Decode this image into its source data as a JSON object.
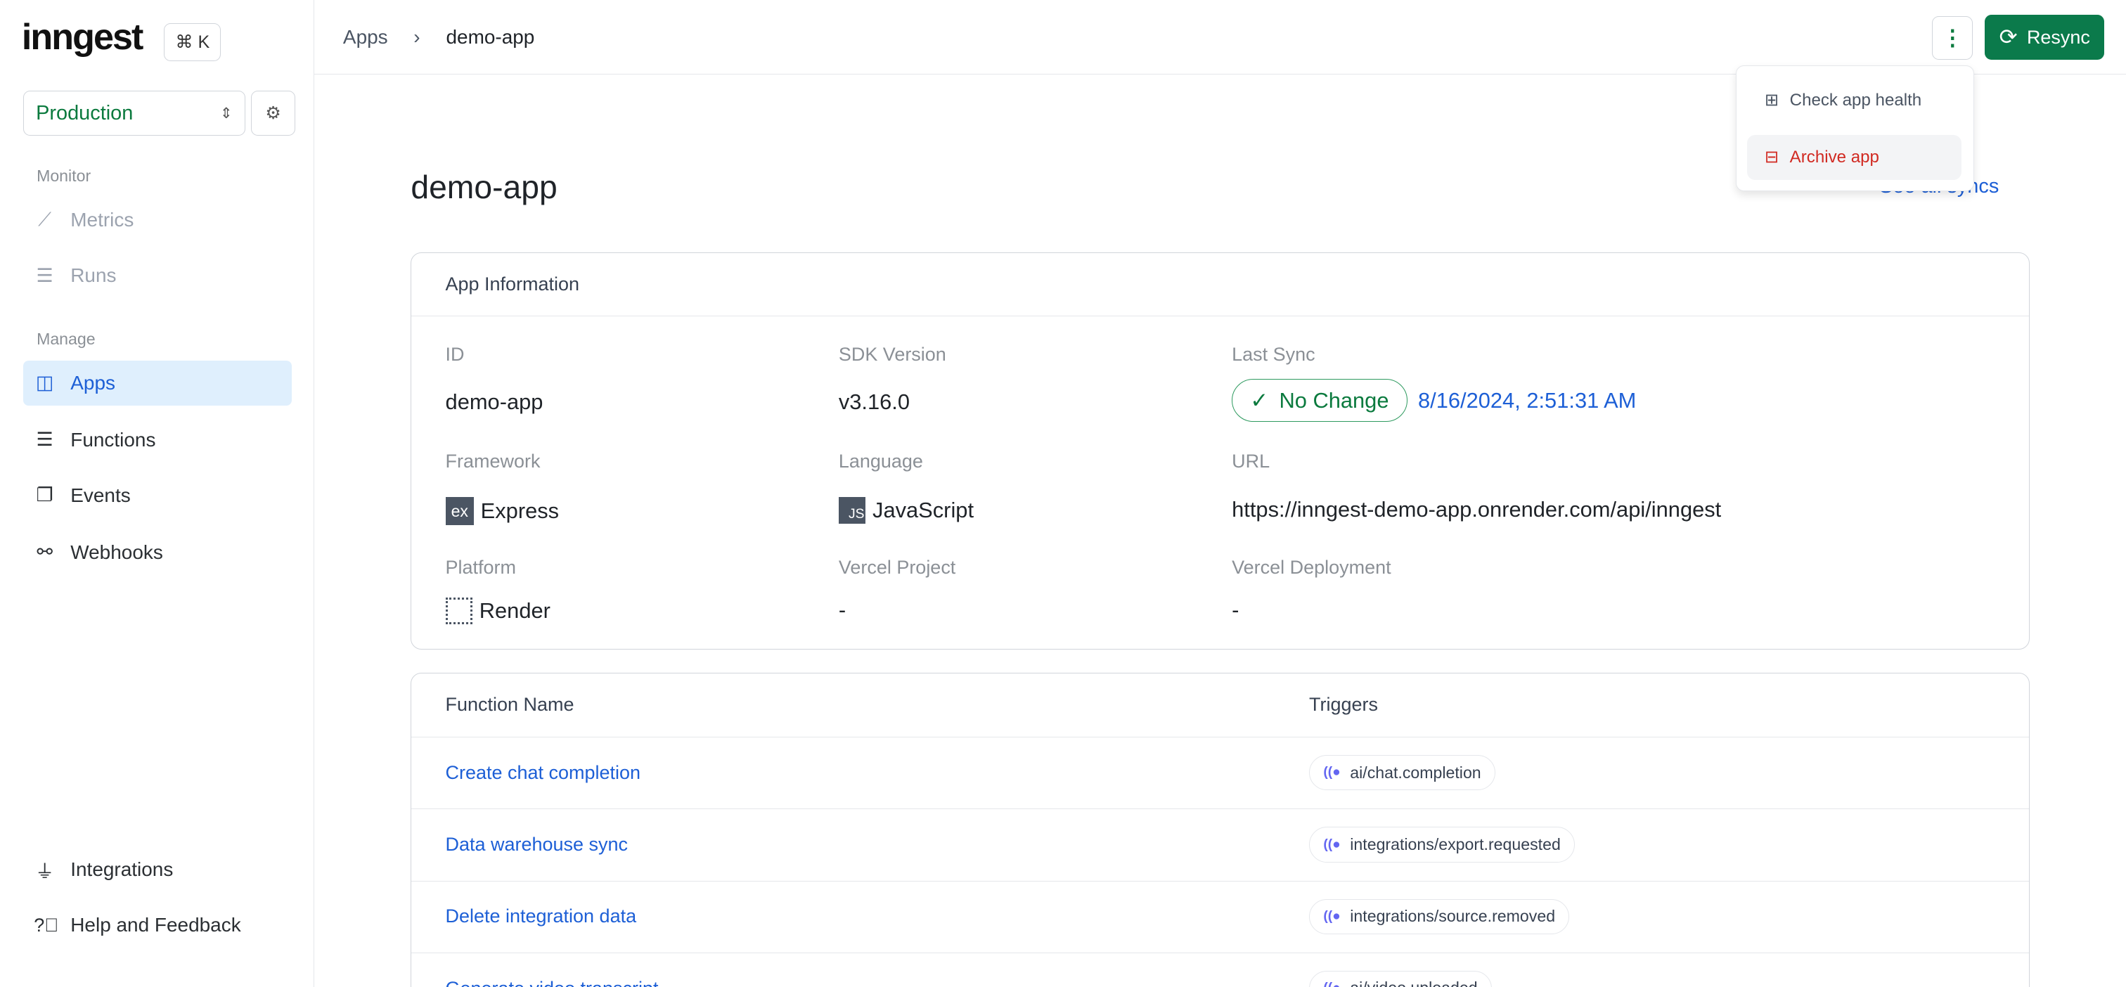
{
  "sidebar": {
    "logo": "inngest",
    "shortcut": "⌘ K",
    "environment": "Production",
    "monitor_label": "Monitor",
    "manage_label": "Manage",
    "items": [
      {
        "label": "Metrics"
      },
      {
        "label": "Runs"
      },
      {
        "label": "Apps"
      },
      {
        "label": "Functions"
      },
      {
        "label": "Events"
      },
      {
        "label": "Webhooks"
      }
    ],
    "bottom": [
      {
        "label": "Integrations"
      },
      {
        "label": "Help and Feedback"
      }
    ]
  },
  "breadcrumb": {
    "root": "Apps",
    "current": "demo-app"
  },
  "header": {
    "resync_label": "Resync"
  },
  "menu": {
    "items": [
      {
        "label": "Check app health"
      },
      {
        "label": "Archive app"
      }
    ]
  },
  "page": {
    "title": "demo-app",
    "see_all": "See all syncs"
  },
  "app_info": {
    "heading": "App Information",
    "id_label": "ID",
    "id": "demo-app",
    "sdk_label": "SDK Version",
    "sdk": "v3.16.0",
    "sync_label": "Last Sync",
    "sync_status": "No Change",
    "sync_time": "8/16/2024, 2:51:31 AM",
    "framework_label": "Framework",
    "framework": "Express",
    "framework_icon": "ex",
    "language_label": "Language",
    "language": "JavaScript",
    "language_icon": "JS",
    "url_label": "URL",
    "url": "https://inngest-demo-app.onrender.com/api/inngest",
    "platform_label": "Platform",
    "platform": "Render",
    "vercel_project_label": "Vercel Project",
    "vercel_project": "-",
    "vercel_deploy_label": "Vercel Deployment",
    "vercel_deploy": "-"
  },
  "functions": {
    "col_name": "Function Name",
    "col_triggers": "Triggers",
    "rows": [
      {
        "name": "Create chat completion",
        "trigger": "ai/chat.completion"
      },
      {
        "name": "Data warehouse sync",
        "trigger": "integrations/export.requested"
      },
      {
        "name": "Delete integration data",
        "trigger": "integrations/source.removed"
      },
      {
        "name": "Generate video transcript",
        "trigger": "ai/video.uploaded"
      }
    ]
  },
  "colors": {
    "brand_green": "#0b7a4b",
    "link_blue": "#1d5fd6",
    "danger_red": "#d12a22"
  }
}
